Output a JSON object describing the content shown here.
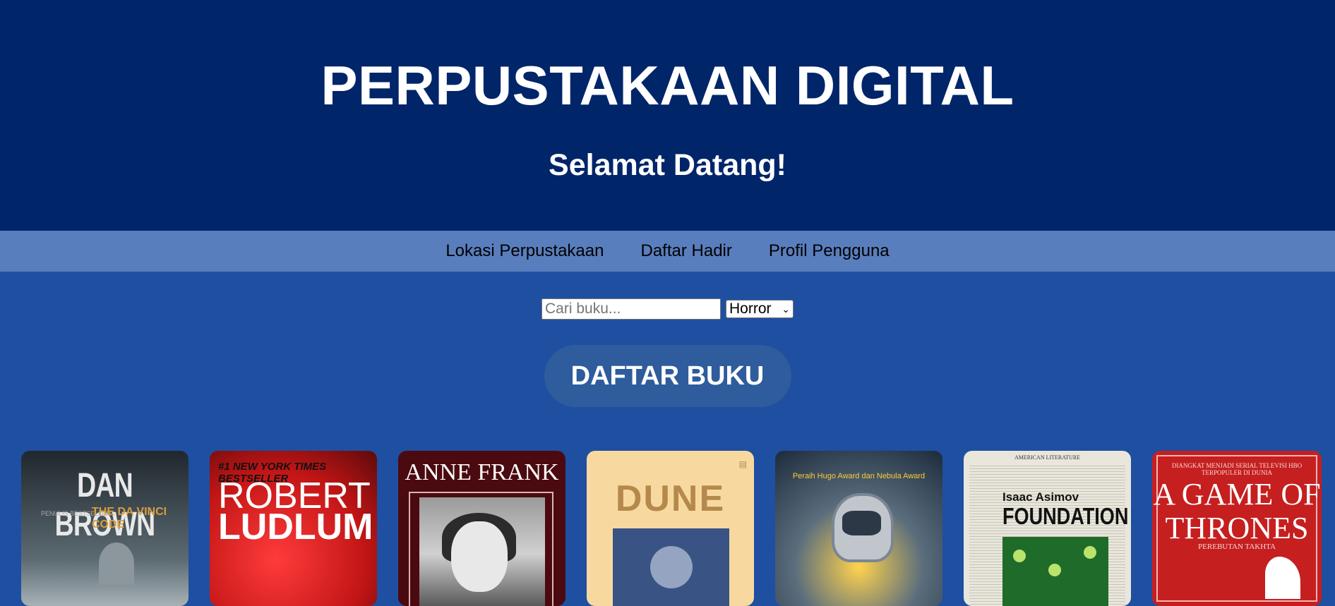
{
  "header": {
    "title": "PERPUSTAKAAN DIGITAL",
    "subtitle": "Selamat Datang!"
  },
  "nav": {
    "items": [
      {
        "label": "Lokasi Perpustakaan"
      },
      {
        "label": "Daftar Hadir"
      },
      {
        "label": "Profil Pengguna"
      }
    ]
  },
  "search": {
    "placeholder": "Cari buku...",
    "genre_selected": "Horror"
  },
  "section": {
    "title": "DAFTAR BUKU"
  },
  "books": [
    {
      "lines": [
        "DAN BROWN",
        "PENULIS BESTSELLER",
        "THE DA VINCI CODE"
      ]
    },
    {
      "lines": [
        "#1 NEW YORK TIMES BESTSELLER",
        "ROBERT",
        "LUDLUM"
      ]
    },
    {
      "lines": [
        "ANNE FRANK"
      ]
    },
    {
      "lines": [
        "DUNE"
      ]
    },
    {
      "lines": [
        "Peraih Hugo Award dan Nebula Award"
      ]
    },
    {
      "lines": [
        "AMERICAN LITERATURE",
        "Isaac Asimov",
        "FOUNDATION"
      ]
    },
    {
      "lines": [
        "DIANGKAT MENJADI SERIAL TELEVISI HBO TERPOPULER DI DUNIA",
        "A GAME OF THRONES",
        "PEREBUTAN TAKHTA"
      ]
    }
  ],
  "colors": {
    "header_bg": "#002569",
    "nav_bg": "#597ebd",
    "body_bg": "#1f4fa1",
    "button_bg": "#2e5c9c"
  }
}
